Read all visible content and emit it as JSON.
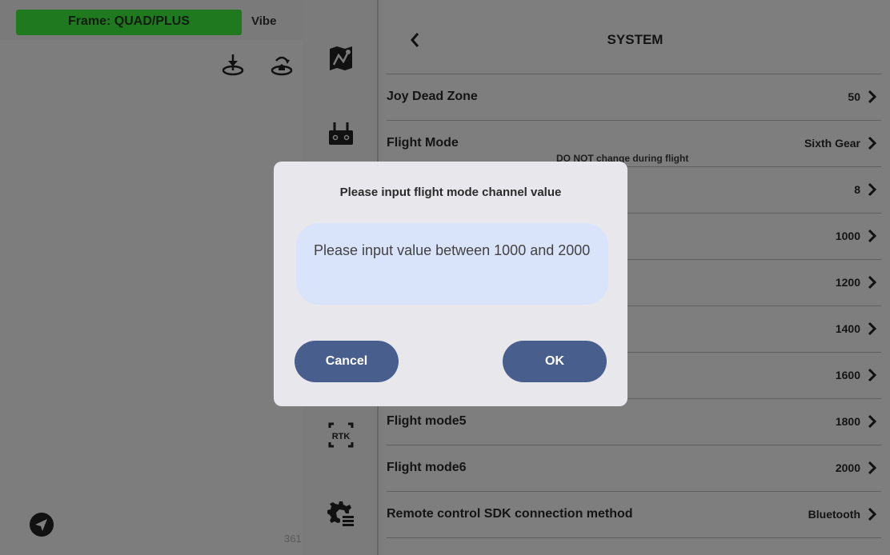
{
  "left_panel": {
    "frame_badge": "Frame: QUAD/PLUS",
    "vibe_label": "Vibe",
    "corner_number": "361"
  },
  "icon_column": {
    "icons": [
      "map-icon",
      "remote-controller-icon",
      "rtk-icon",
      "settings-icon"
    ],
    "rtk_label": "RTK"
  },
  "settings": {
    "title": "SYSTEM",
    "rows": [
      {
        "label": "Joy Dead Zone",
        "value": "50"
      },
      {
        "label": "Flight Mode",
        "value": "Sixth Gear",
        "hint": "DO NOT change during flight"
      },
      {
        "label": "",
        "value": "8"
      },
      {
        "label": "",
        "value": "1000"
      },
      {
        "label": "",
        "value": "1200"
      },
      {
        "label": "",
        "value": "1400"
      },
      {
        "label": "",
        "value": "1600"
      },
      {
        "label": "Flight mode5",
        "value": "1800"
      },
      {
        "label": "Flight mode6",
        "value": "2000"
      },
      {
        "label": "Remote control SDK connection method",
        "value": "Bluetooth"
      }
    ]
  },
  "modal": {
    "title": "Please input flight mode channel value",
    "input_placeholder": "Please input value between 1000 and 2000",
    "input_value": "",
    "cancel_label": "Cancel",
    "ok_label": "OK"
  },
  "colors": {
    "frame_badge": "#1f7a1f",
    "button": "#485f8e",
    "input_bg": "#d9e4fb",
    "modal_bg": "#e8e8ec"
  }
}
